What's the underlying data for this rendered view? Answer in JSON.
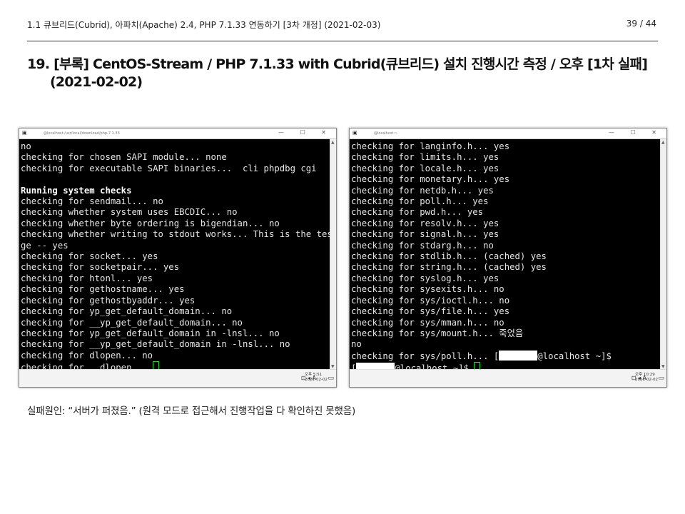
{
  "header": {
    "left": "1.1 큐브리드(Cubrid), 아파치(Apache) 2.4, PHP 7.1.33 연동하기 [3차 개정] (2021-02-03)",
    "page": "39 / 44"
  },
  "title": {
    "line1": "19. [부록] CentOS-Stream / PHP 7.1.33 with Cubrid(큐브리드) 설치 진행시간 측정 / 오후 [1차 실패]",
    "line2": "(2021-02-02)"
  },
  "window_left": {
    "title": "@localhost:/usr/local/download/php-7.1.33",
    "controls": "— ☐ ✕",
    "lines_before_bold": "no\nchecking for chosen SAPI module... none\nchecking for executable SAPI binaries...  cli phpdbg cgi\n\n",
    "bold_line": "Running system checks",
    "lines_after_bold": "\nchecking for sendmail... no\nchecking whether system uses EBCDIC... no\nchecking whether byte ordering is bigendian... no\nchecking whether writing to stdout works... This is the test messa\nge -- yes\nchecking for socket... yes\nchecking for socketpair... yes\nchecking for htonl... yes\nchecking for gethostname... yes\nchecking for gethostbyaddr... yes\nchecking for yp_get_default_domain... no\nchecking for __yp_get_default_domain... no\nchecking for yp_get_default_domain in -lnsl... no\nchecking for __yp_get_default_domain in -lnsl... no\nchecking for dlopen... no\nchecking for __dlopen... ",
    "clock_time": "오후 5:51",
    "clock_date": "2021-02-02",
    "tray_lang": "A"
  },
  "window_right": {
    "title": "@localhost:~",
    "controls": "— ☐ ✕",
    "lines": "checking for langinfo.h... yes\nchecking for limits.h... yes\nchecking for locale.h... yes\nchecking for monetary.h... yes\nchecking for netdb.h... yes\nchecking for poll.h... yes\nchecking for pwd.h... yes\nchecking for resolv.h... yes\nchecking for signal.h... yes\nchecking for stdarg.h... no\nchecking for stdlib.h... (cached) yes\nchecking for string.h... (cached) yes\nchecking for syslog.h... yes\nchecking for sysexits.h... no\nchecking for sys/ioctl.h... no\nchecking for sys/file.h... yes\nchecking for sys/mman.h... no\nchecking for sys/mount.h... 죽었음\nno\nchecking for sys/poll.h... [",
    "prompt1_suffix": "@localhost ~]$",
    "prompt2_prefix": "[",
    "prompt2_suffix": "@localhost ~]$ ",
    "clock_time": "오후 10:29",
    "clock_date": "2021-02-02",
    "tray_lang": "A"
  },
  "caption": "실패원인: “서버가 퍼졌음.” (원격 모드로 접근해서 진행작업을 다 확인하진 못했음)"
}
